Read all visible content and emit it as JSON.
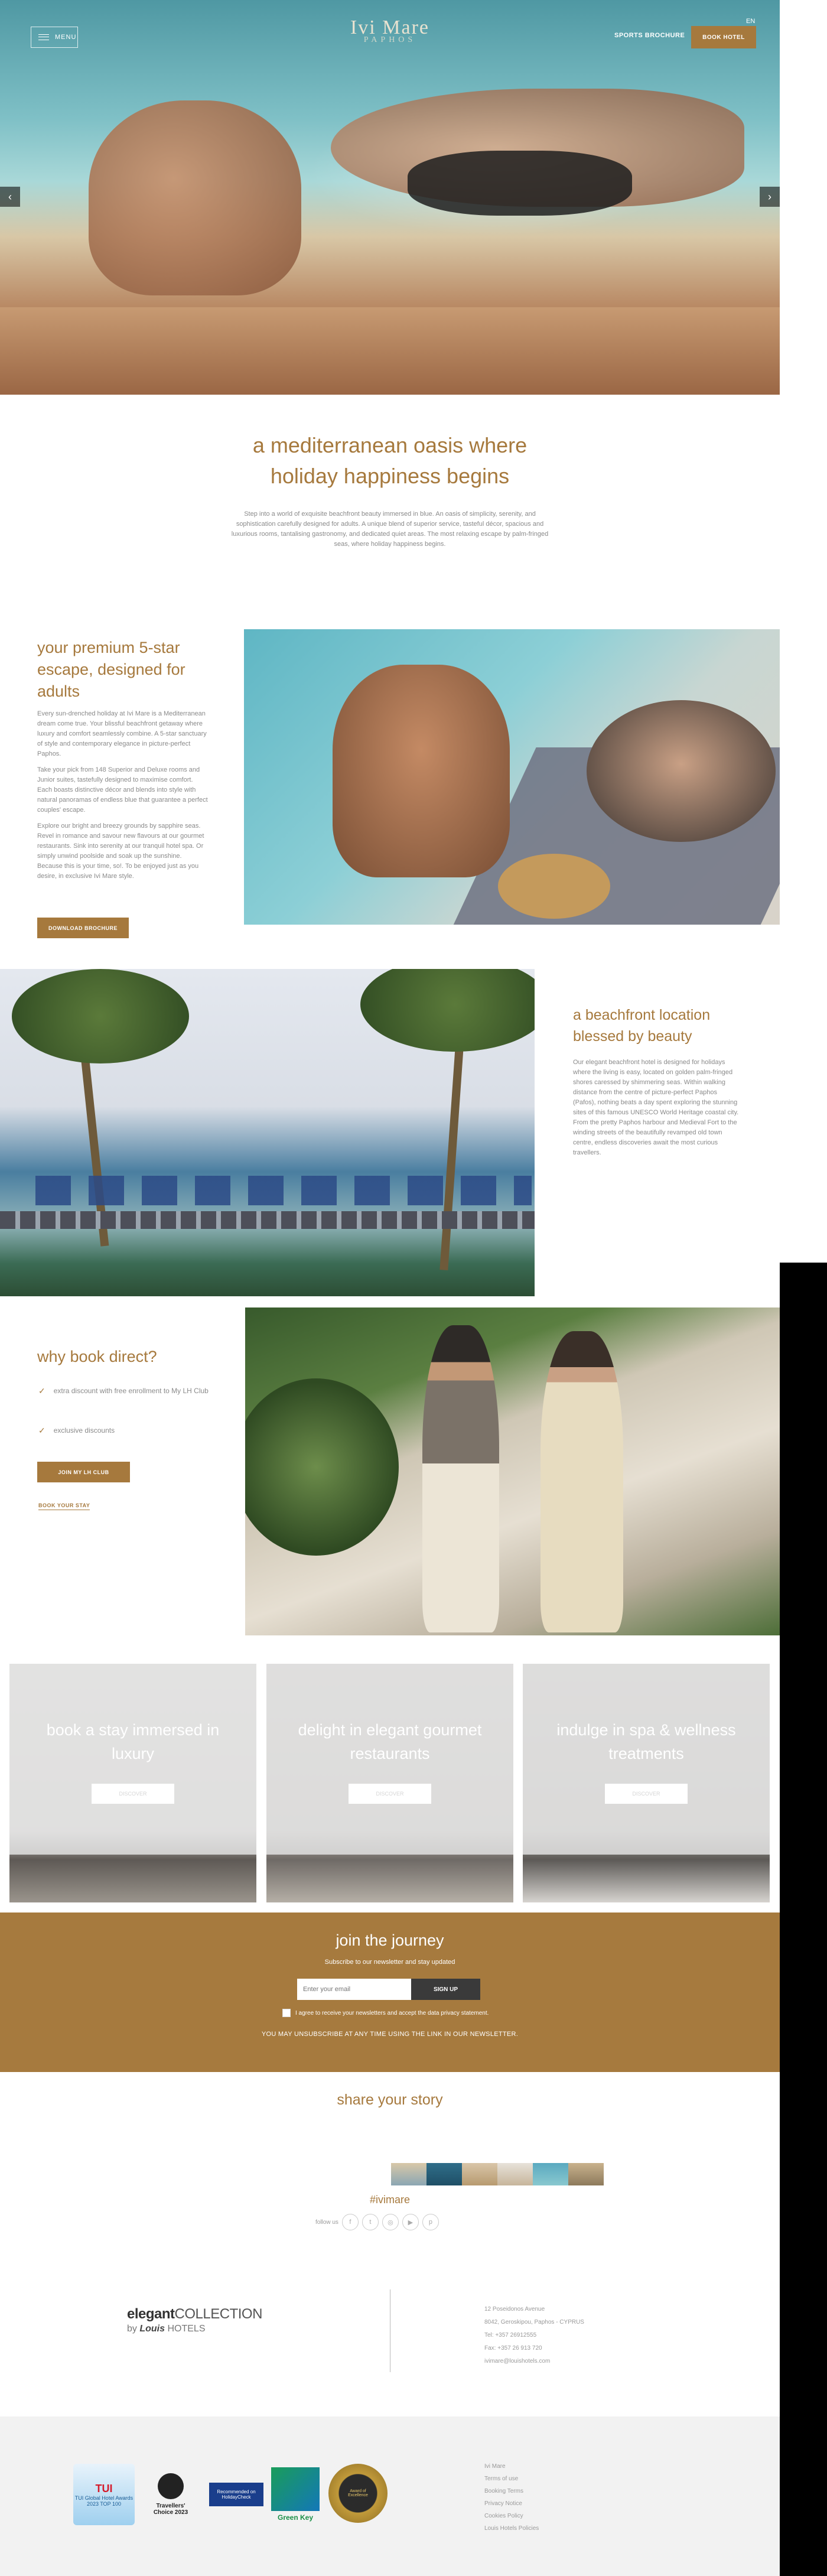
{
  "header": {
    "menu_label": "MENU",
    "logo_main": "Ivi Mare",
    "logo_sub": "PAPHOS",
    "brochure_label": "SPORTS BROCHURE",
    "book_label": "BOOK HOTEL",
    "lang": "EN"
  },
  "intro": {
    "title_line1": "a mediterranean oasis where",
    "title_line2": "holiday happiness begins",
    "text": "Step into a world of exquisite beachfront beauty immersed in blue. An oasis of simplicity, serenity, and sophistication carefully designed for adults. A unique blend of superior service, tasteful décor, spacious and luxurious rooms, tantalising gastronomy, and dedicated quiet areas. The most relaxing escape by palm-fringed seas, where holiday happiness begins."
  },
  "premium": {
    "title": "your premium 5-star escape, designed for adults",
    "paragraphs": [
      "Every sun-drenched holiday at Ivi Mare is a Mediterranean dream come true. Your blissful beachfront getaway where luxury and comfort seamlessly combine. A 5-star sanctuary of style and contemporary elegance in picture-perfect Paphos.",
      "Take your pick from 148 Superior and Deluxe rooms and Junior suites, tastefully designed to maximise comfort. Each boasts distinctive décor and blends into style with natural panoramas of endless blue that guarantee a perfect couples' escape.",
      "Explore our bright and breezy grounds by sapphire seas. Revel in romance and savour new flavours at our gourmet restaurants. Sink into serenity at our tranquil hotel spa. Or simply unwind poolside and soak up the sunshine. Because this is your time, so!. To be enjoyed just as you desire, in exclusive Ivi Mare style."
    ],
    "button": "DOWNLOAD BROCHURE"
  },
  "beachfront": {
    "title": "a beachfront location blessed by beauty",
    "text": "Our elegant beachfront hotel is designed for holidays where the living is easy, located on golden palm-fringed shores caressed by shimmering seas. Within walking distance from the centre of picture-perfect Paphos (Pafos), nothing beats a day spent exploring the stunning sites of this famous UNESCO World Heritage coastal city. From the pretty Paphos harbour and Medieval Fort to the winding streets of the beautifully revamped old town centre, endless discoveries await the most curious travellers."
  },
  "why": {
    "title": "why book direct?",
    "items": [
      "extra discount with free enrollment to My LH Club",
      "exclusive discounts"
    ],
    "button": "JOIN MY LH CLUB",
    "link": "BOOK YOUR STAY"
  },
  "cards": [
    {
      "title": "book a stay immersed in luxury",
      "button": "DISCOVER"
    },
    {
      "title": "delight in elegant gourmet restaurants",
      "button": "DISCOVER"
    },
    {
      "title": "indulge in spa & wellness treatments",
      "button": "DISCOVER"
    }
  ],
  "newsletter": {
    "title": "join the journey",
    "subtitle": "Subscribe to our newsletter and stay updated",
    "placeholder": "Enter your email",
    "button": "SIGN UP",
    "consent": "I agree to receive your newsletters and accept the data privacy statement.",
    "unsubscribe": "YOU MAY UNSUBSCRIBE AT ANY TIME USING THE LINK IN OUR NEWSLETTER."
  },
  "story": {
    "title": "share your story",
    "hashtag": "#ivimare",
    "follow_label": "follow us",
    "socials": [
      "facebook-icon",
      "twitter-icon",
      "instagram-icon",
      "youtube-icon",
      "pinterest-icon"
    ]
  },
  "footer": {
    "collection_1": "elegant",
    "collection_2": "COLLECTION",
    "by": "by",
    "brand": "Louis",
    "brand_hotels": "HOTELS",
    "address": [
      "12 Poseidonos Avenue",
      "8042, Geroskipou, Paphos - CYPRUS",
      "Tel: +357 26912555",
      "Fax: +357 26 913 720",
      "ivimare@louishotels.com"
    ],
    "links": [
      "Ivi Mare",
      "Terms of use",
      "Booking Terms",
      "Privacy Notice",
      "Cookies Policy",
      "Louis Hotels Policies"
    ],
    "awards": [
      "TUI Global Hotel Awards 2023 TOP 100",
      "Travellers' Choice 2023",
      "Recommended on HolidayCheck",
      "Green Key",
      "Award of Excellence"
    ]
  },
  "colors": {
    "accent": "#a6793d",
    "newsletter_bg": "#a67a3e",
    "footer_bg": "#f2f2f2"
  }
}
